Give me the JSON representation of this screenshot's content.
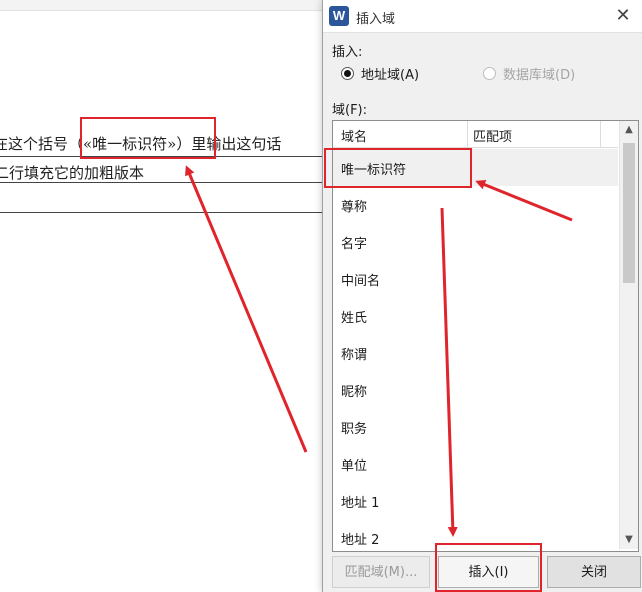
{
  "document": {
    "line1": "在这个括号（«唯一标识符»）里输出这句话",
    "line2": "二行填充它的加粗版本"
  },
  "dialog": {
    "icon_letter": "W",
    "title": "插入域",
    "close_glyph": "✕",
    "insert_label": "插入:",
    "radio_address": "地址域(A)",
    "radio_database": "数据库域(D)",
    "fields_label": "域(F):",
    "columns": [
      "域名",
      "匹配项"
    ],
    "items": [
      "唯一标识符",
      "尊称",
      "名字",
      "中间名",
      "姓氏",
      "称谓",
      "昵称",
      "职务",
      "单位",
      "地址 1",
      "地址 2"
    ],
    "buttons": {
      "match": "匹配域(M)...",
      "insert": "插入(I)",
      "close": "关闭"
    }
  },
  "colors": {
    "annotation": "#e0242b",
    "app_icon": "#2b579a"
  }
}
